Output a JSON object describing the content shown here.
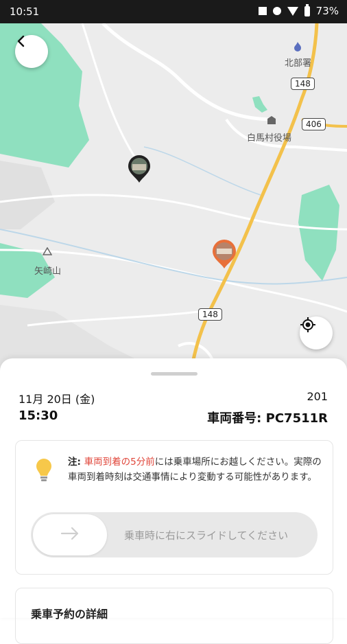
{
  "status_bar": {
    "time": "10:51",
    "battery": "73%"
  },
  "map": {
    "labels": {
      "kitabe": "北部署",
      "hakuba_office": "白馬村役場",
      "yazaki": "矢崎山"
    },
    "road_shields": {
      "r148_top": "148",
      "r406": "406",
      "r148_bottom": "148"
    },
    "colors": {
      "road": "#f3c14b",
      "park": "#7fd8b0",
      "pin_active": "#e8703a",
      "pin_other": "#222222"
    }
  },
  "trip": {
    "date": "11月 20日 (金)",
    "time": "15:30",
    "route_number": "201",
    "vehicle_number": "車両番号: PC7511R"
  },
  "notice": {
    "prefix": "注: ",
    "highlight": "車両到着の5分前",
    "body": "には乗車場所にお越しください。実際の車両到着時刻は交通事情により変動する可能性があります。"
  },
  "slider": {
    "label": "乗車時に右にスライドしてください"
  },
  "details": {
    "title": "乗車予約の詳細"
  }
}
